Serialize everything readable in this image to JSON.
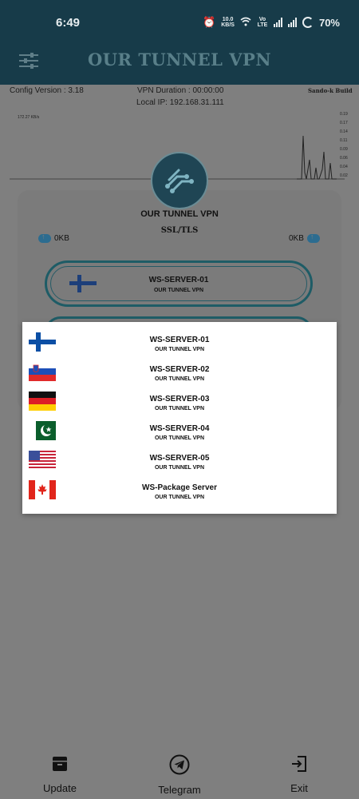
{
  "status_bar": {
    "time": "6:49",
    "net_speed_value": "10.0",
    "net_speed_unit": "KB/S",
    "volte": "Vo LTE",
    "battery": "70%"
  },
  "app": {
    "title": "OUR TUNNEL VPN"
  },
  "info": {
    "config_version": "Config Version : 3.18",
    "vpn_duration": "VPN Duration : 00:00:00",
    "build": "Sando-k Build",
    "local_ip": "Local IP: 192.168.31.111"
  },
  "graph": {
    "max_label": "172.27 KB/s",
    "axis_labels": [
      "0.19",
      "0.17",
      "0.14",
      "0.11",
      "0.09",
      "0.06",
      "0.04",
      "0.02",
      "0.00"
    ]
  },
  "connection": {
    "logo_text": "OUR TUNNEL VPN",
    "protocol": "SSL/TLS",
    "download": "0KB",
    "upload": "0KB",
    "selected_server": {
      "name": "WS-SERVER-01",
      "subtitle": "OUR TUNNEL VPN",
      "flag": "finland"
    }
  },
  "server_list": [
    {
      "name": "WS-SERVER-01",
      "subtitle": "OUR TUNNEL VPN",
      "flag": "finland"
    },
    {
      "name": "WS-SERVER-02",
      "subtitle": "OUR TUNNEL VPN",
      "flag": "slovenia"
    },
    {
      "name": "WS-SERVER-03",
      "subtitle": "OUR TUNNEL VPN",
      "flag": "germany"
    },
    {
      "name": "WS-SERVER-04",
      "subtitle": "OUR TUNNEL VPN",
      "flag": "pakistan"
    },
    {
      "name": "WS-SERVER-05",
      "subtitle": "OUR TUNNEL VPN",
      "flag": "usa"
    },
    {
      "name": "WS-Package Server",
      "subtitle": "OUR TUNNEL VPN",
      "flag": "canada"
    }
  ],
  "nav": {
    "update": {
      "label": "Update",
      "icon": "archive-icon"
    },
    "telegram": {
      "label": "Telegram",
      "icon": "telegram-icon"
    },
    "exit": {
      "label": "Exit",
      "icon": "exit-icon"
    }
  }
}
